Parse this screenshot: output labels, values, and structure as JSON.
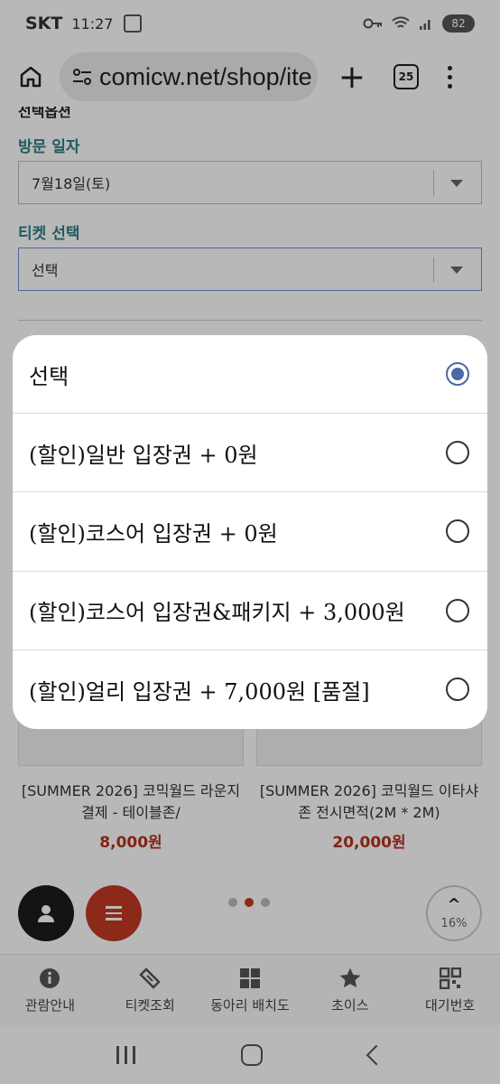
{
  "status_bar": {
    "carrier": "SKT",
    "time": "11:27",
    "battery": "82"
  },
  "browser": {
    "url": "comicw.net/shop/ite",
    "tab_count": "25"
  },
  "form": {
    "section_title": "선택옵션",
    "visit_date_label": "방문 일자",
    "visit_date_value": "7월18일(토)",
    "ticket_label": "티켓 선택",
    "ticket_value": "선택"
  },
  "products": [
    {
      "name": "[SUMMER 2026] 코믹월드 라운지 결제 - 테이블존/",
      "price": "8,000원"
    },
    {
      "name": "[SUMMER 2026] 코믹월드 이타샤존 전시면적(2M * 2M)",
      "price": "20,000원"
    }
  ],
  "scroll_progress": "16%",
  "bottom_nav": [
    {
      "label": "관람안내",
      "icon": "info-icon"
    },
    {
      "label": "티켓조회",
      "icon": "ticket-icon"
    },
    {
      "label": "동아리 배치도",
      "icon": "grid-icon"
    },
    {
      "label": "초이스",
      "icon": "star-icon"
    },
    {
      "label": "대기번호",
      "icon": "qr-icon"
    }
  ],
  "dialog": {
    "selected_index": 0,
    "options": [
      {
        "label": "선택"
      },
      {
        "label": "(할인)일반 입장권  + 0원"
      },
      {
        "label": "(할인)코스어 입장권  + 0원"
      },
      {
        "label": "(할인)코스어 입장권&패키지  + 3,000원"
      },
      {
        "label": "(할인)얼리 입장권  + 7,000원  [품절]"
      }
    ]
  },
  "colors": {
    "accent_teal": "#2f7f86",
    "price_red": "#b5331d",
    "radio_blue": "#4d67a8"
  }
}
